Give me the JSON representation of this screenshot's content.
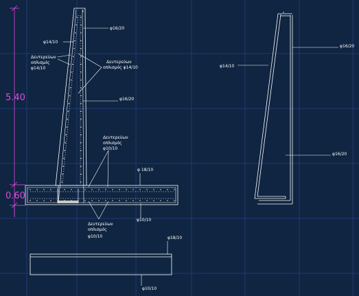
{
  "dimensions": {
    "wall_height": "5.40",
    "base_thickness": "0.60"
  },
  "section_labels": {
    "phi16_20_top": "φ16/20",
    "phi14_10_left": "φ14/10",
    "secondary_left": [
      "Δευτερεύων",
      "οπλισμός",
      "φ14/10"
    ],
    "secondary_right": [
      "Δευτερεύων",
      "οπλισμός φ14/10"
    ],
    "phi16_20_mid": "φ16/20",
    "secondary_base_top": [
      "Δευτερεύων",
      "οπλισμός",
      "φ10/10"
    ],
    "phi18_10_base": "φ 18/10",
    "secondary_base_bottom": [
      "Δευτερεύων",
      "οπλισμός",
      "φ10/10"
    ],
    "phi10_10_base": "φ10/10"
  },
  "stem_detail_labels": {
    "phi16_20_top": "φ16/20",
    "phi14_10": "φ14/10",
    "phi16_20_bottom": "φ16/20"
  },
  "footing_detail_labels": {
    "phi18_10": "φ18/10",
    "phi10_10": "φ10/10"
  },
  "colors": {
    "background": "#0f2541",
    "grid": "#2a3f8e",
    "linework": "#ffffff",
    "dimension": "#e04ae0"
  }
}
